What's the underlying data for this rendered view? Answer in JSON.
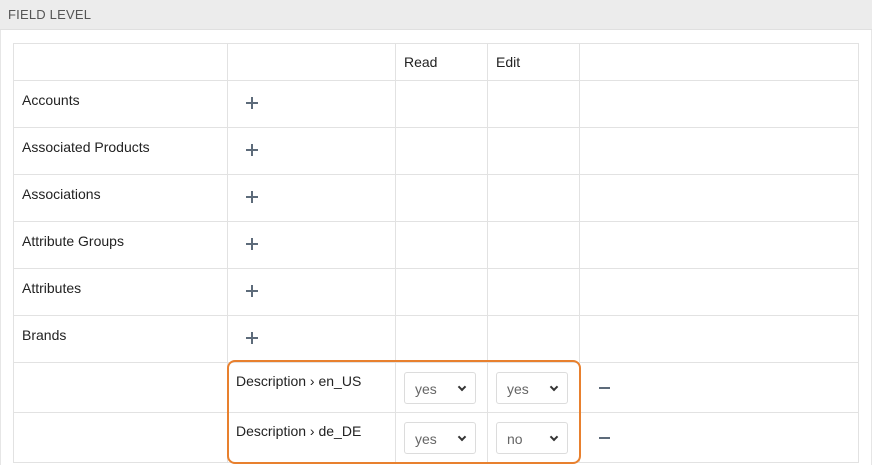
{
  "section": {
    "title": "FIELD LEVEL"
  },
  "table": {
    "headers": [
      "",
      "",
      "Read",
      "Edit",
      ""
    ],
    "entities": [
      {
        "name": "Accounts",
        "add_icon": "plus-icon"
      },
      {
        "name": "Associated Products",
        "add_icon": "plus-icon"
      },
      {
        "name": "Associations",
        "add_icon": "plus-icon"
      },
      {
        "name": "Attribute Groups",
        "add_icon": "plus-icon"
      },
      {
        "name": "Attributes",
        "add_icon": "plus-icon"
      },
      {
        "name": "Brands",
        "add_icon": "plus-icon"
      }
    ],
    "fields": [
      {
        "name": "Description › en_US",
        "read": "yes",
        "edit": "yes",
        "remove_icon": "minus-icon"
      },
      {
        "name": "Description › de_DE",
        "read": "yes",
        "edit": "no",
        "remove_icon": "minus-icon"
      }
    ]
  },
  "highlight_color": "#e8802e",
  "icon_color": "#5d6b7a"
}
